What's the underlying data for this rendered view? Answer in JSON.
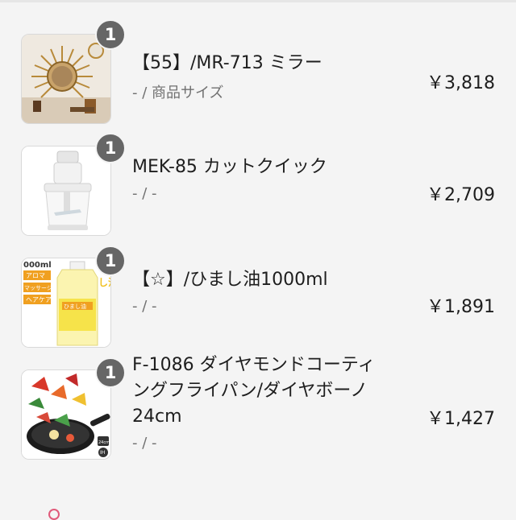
{
  "items": [
    {
      "quantity": "1",
      "title": "【55】/MR-713 ミラー",
      "subtitle": "- / 商品サイズ",
      "price": "￥3,818",
      "thumb_icon": "sunburst-mirror-image"
    },
    {
      "quantity": "1",
      "title": "MEK-85 カットクイック",
      "subtitle": "- / -",
      "price": "￥2,709",
      "thumb_icon": "food-chopper-image"
    },
    {
      "quantity": "1",
      "title": "【☆】/ひまし油1000ml",
      "subtitle": "- / -",
      "price": "￥1,891",
      "thumb_icon": "castor-oil-bottle-image",
      "thumb_text": {
        "volume": "000ml",
        "tags": [
          "アロマ",
          "マッサージ",
          "ヘアケア"
        ],
        "bottle_label": "ひまし油",
        "side_text": "し油"
      }
    },
    {
      "quantity": "1",
      "title": "F-1086 ダイヤモンドコーティングフライパン/ダイヤボーノ24cm",
      "subtitle": "- / -",
      "price": "￥1,427",
      "thumb_icon": "frying-pan-image",
      "thumb_text": {
        "size": "24cm",
        "ih": "IH"
      }
    }
  ],
  "colors": {
    "background": "#f4f4f4",
    "badge": "#666666",
    "text": "#1e1e1e",
    "subtext": "#707070"
  }
}
